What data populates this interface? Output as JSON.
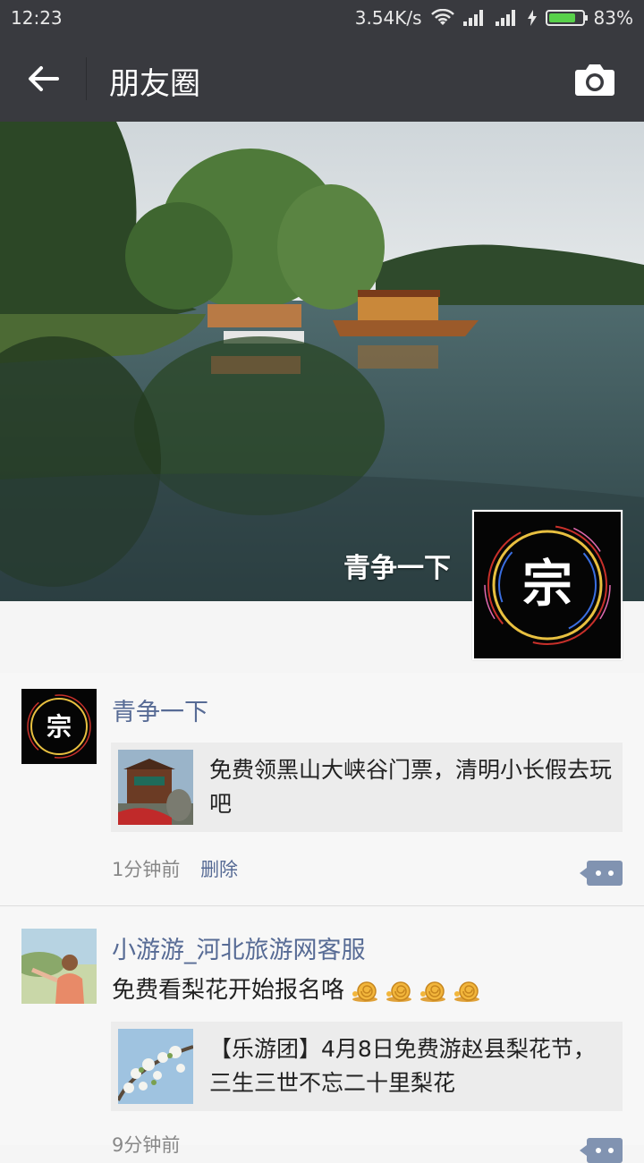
{
  "status": {
    "time": "12:23",
    "speed": "3.54K/s",
    "battery": "83%",
    "battery_level": 0.83
  },
  "titlebar": {
    "title": "朋友圈",
    "back_icon": "arrow-left-icon",
    "camera_icon": "camera-icon"
  },
  "cover": {
    "name": "青争一下",
    "avatar_char": "宗"
  },
  "posts": [
    {
      "name": "青争一下",
      "avatar_char": "宗",
      "share_text": "免费领黑山大峡谷门票，清明小长假去玩吧",
      "time": "1分钟前",
      "delete": "删除"
    },
    {
      "name": "小游游_河北旅游网客服",
      "text": "免费看梨花开始报名咯",
      "emoji_count": 4,
      "share_text": "【乐游团】4月8日免费游赵县梨花节，三生三世不忘二十里梨花",
      "time": "9分钟前"
    }
  ]
}
